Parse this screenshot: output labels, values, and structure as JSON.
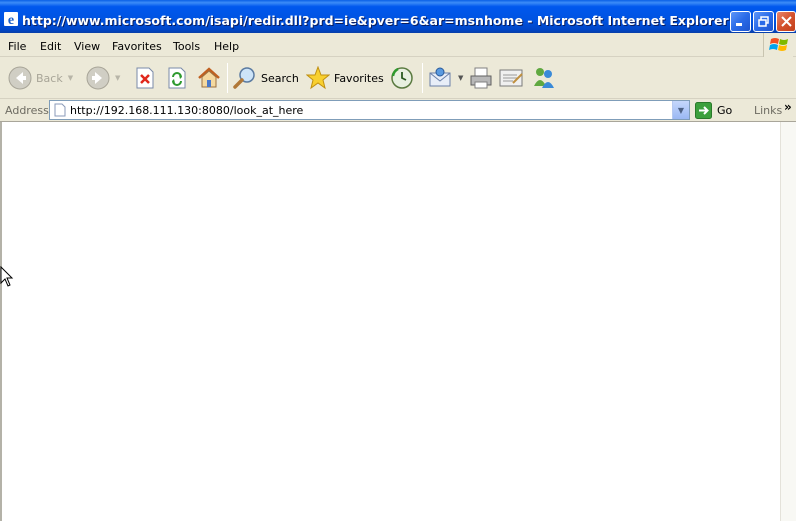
{
  "window": {
    "title": "http://www.microsoft.com/isapi/redir.dll?prd=ie&pver=6&ar=msnhome - Microsoft Internet Explorer"
  },
  "menu": {
    "items": [
      "File",
      "Edit",
      "View",
      "Favorites",
      "Tools",
      "Help"
    ]
  },
  "toolbar": {
    "back_label": "Back",
    "search_label": "Search",
    "favorites_label": "Favorites"
  },
  "address": {
    "label": "Address",
    "url": "http://192.168.111.130:8080/look_at_here",
    "go_label": "Go",
    "links_label": "Links",
    "links_more": "»"
  },
  "colors": {
    "titlebar": "#0053E1",
    "chrome": "#ECE9D8",
    "content_bg": "#FFFFFF"
  }
}
